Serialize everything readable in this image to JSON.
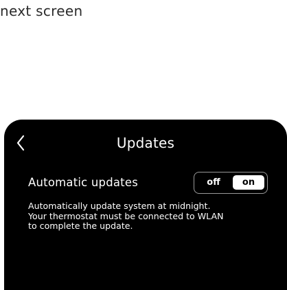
{
  "caption": "next screen",
  "screen": {
    "title": "Updates",
    "back_icon": "chevron-left-icon",
    "setting": {
      "label": "Automatic updates",
      "toggle": {
        "off_label": "off",
        "on_label": "on",
        "selected": "on"
      }
    },
    "description_lines": [
      "Automatically update system at midnight.",
      "Your thermostat must be connected to WLAN",
      "to complete the update."
    ]
  },
  "colors": {
    "screen_background": "#000000",
    "text": "#ffffff",
    "toggle_border": "#9a9a9a",
    "toggle_selected_bg": "#ffffff"
  }
}
